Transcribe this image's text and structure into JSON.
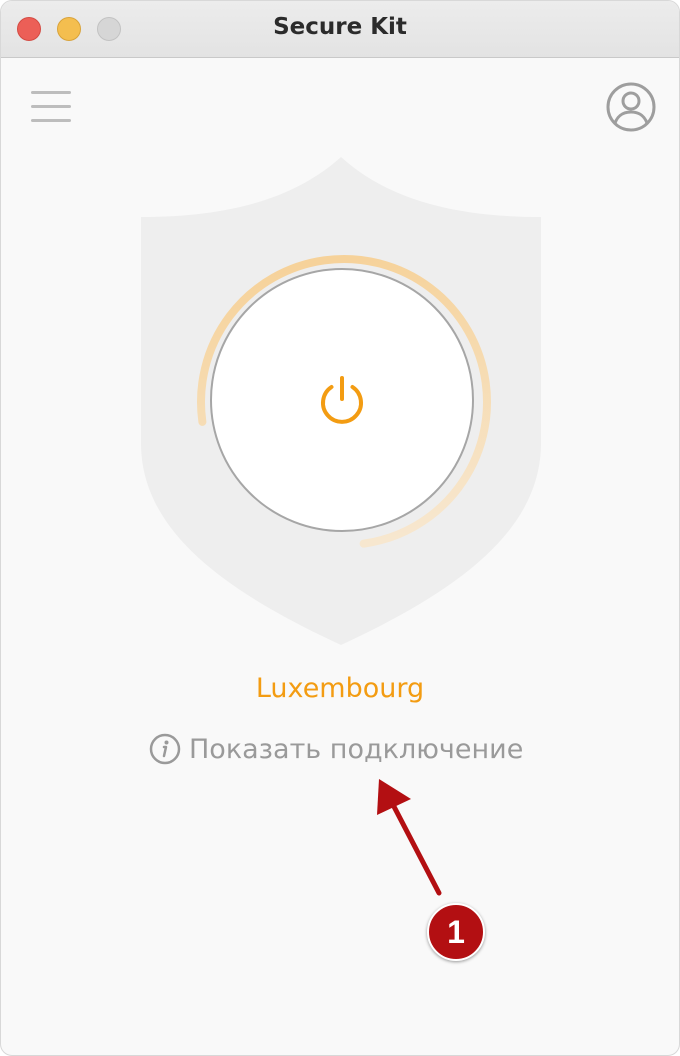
{
  "window": {
    "title": "Secure Kit"
  },
  "toolbar": {
    "menu_icon": "hamburger-menu-icon",
    "account_icon": "user-account-icon"
  },
  "connection": {
    "location": "Luxembourg",
    "show_connection_label": "Показать подключение",
    "info_icon": "info-icon",
    "power_icon": "power-icon",
    "progress": 0.75
  },
  "annotation": {
    "badge_number": "1"
  },
  "colors": {
    "accent": "#f39c12",
    "progress_ring": "#f7d9a8",
    "shield": "#eeeeee",
    "muted_text": "#9a9a9a",
    "annotation_red": "#b30f12"
  }
}
